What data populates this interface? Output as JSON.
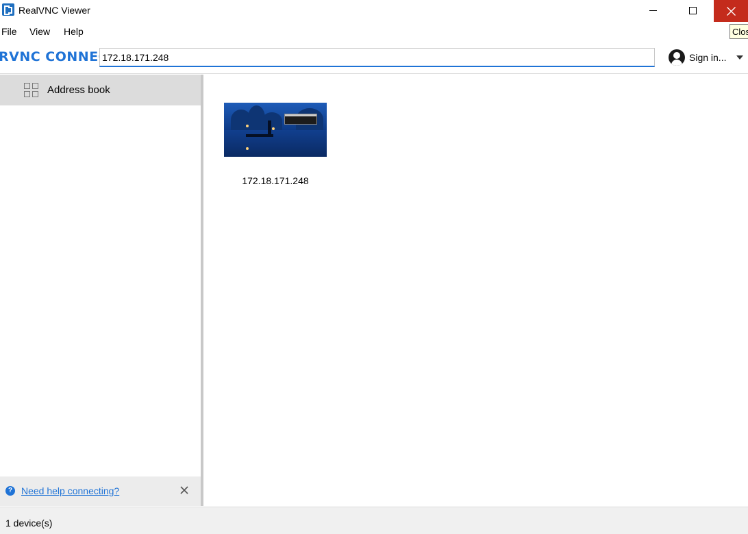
{
  "window": {
    "title": "RealVNC Viewer",
    "tooltip": "Close"
  },
  "menu": {
    "items": [
      "File",
      "View",
      "Help"
    ]
  },
  "toolbar": {
    "logo_text": "RVNC CONNECT",
    "address_value": "172.18.171.248",
    "signin_label": "Sign in..."
  },
  "sidebar": {
    "items": [
      {
        "label": "Address book",
        "icon": "grid-icon"
      }
    ],
    "help_link": "Need help connecting?"
  },
  "main": {
    "devices": [
      {
        "label": "172.18.171.248"
      }
    ]
  },
  "status": {
    "text": "1 device(s)"
  },
  "colors": {
    "accent": "#1f73d6",
    "close_button": "#c42b1c",
    "selected_item": "#dcdcdc"
  }
}
